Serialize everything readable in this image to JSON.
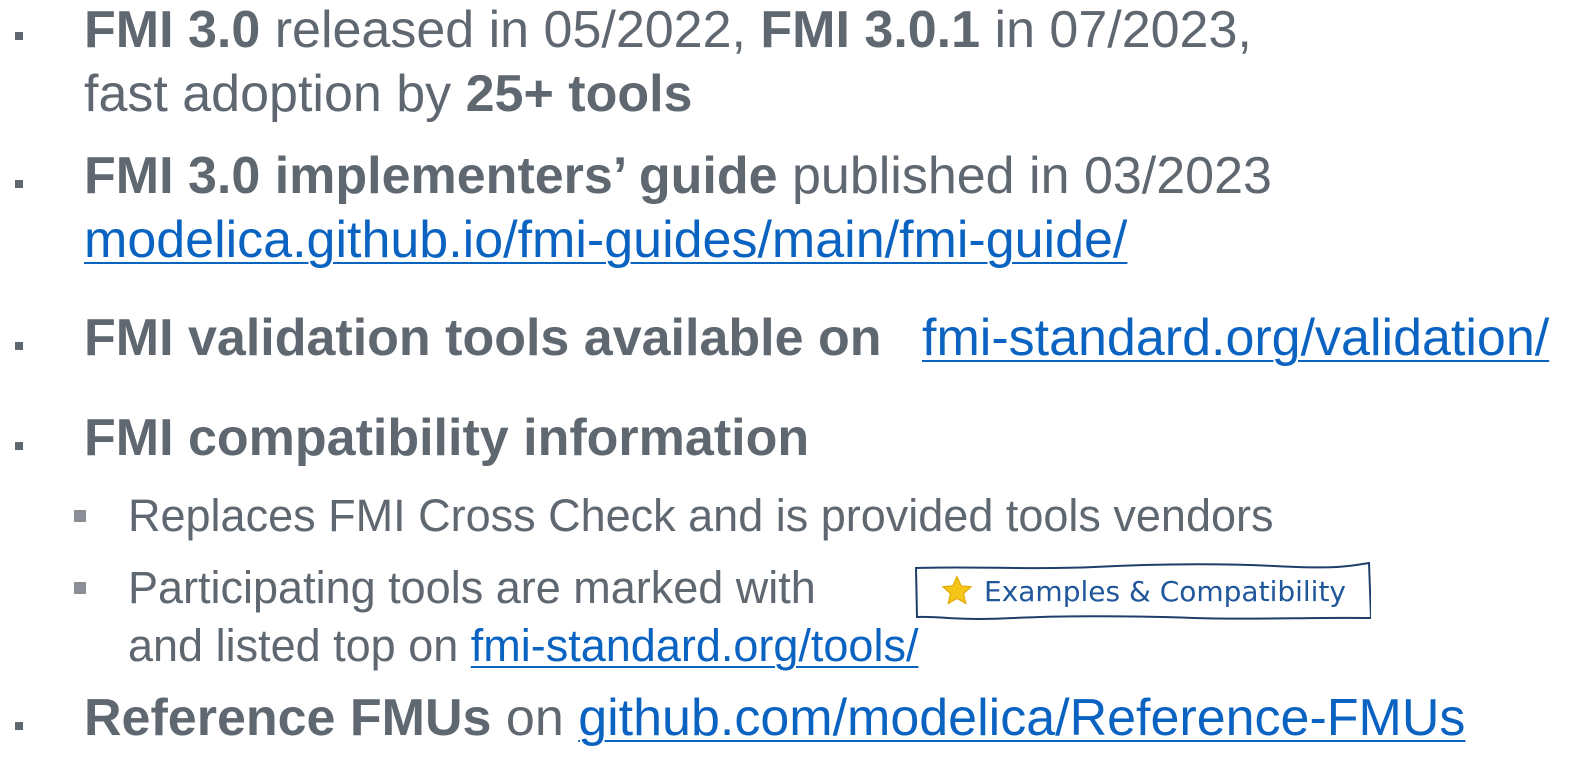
{
  "bullets": {
    "b1": {
      "strong1": "FMI 3.0",
      "text1": " released in 05/2022, ",
      "strong2": "FMI 3.0.1",
      "text2": " in 07/2023,",
      "line2_text": "fast adoption by ",
      "line2_strong": "25+ tools"
    },
    "b2": {
      "strong": "FMI 3.0 implementers’ guide",
      "text": " published in 03/2023",
      "link": "modelica.github.io/fmi-guides/main/fmi-guide/"
    },
    "b3": {
      "strong": "FMI validation tools available on",
      "link": "fmi-standard.org/validation/"
    },
    "b4": {
      "strong": "FMI compatibility information",
      "sub1": "Replaces FMI Cross Check and is provided tools vendors",
      "sub2_line1": "Participating tools are marked with",
      "sub2_line2_text": "and listed top on ",
      "sub2_link": "fmi-standard.org/tools/",
      "badge": {
        "icon": "star-icon",
        "label": "Examples & Compatibility"
      }
    },
    "b5": {
      "strong": "Reference FMUs",
      "text": " on ",
      "link": "github.com/modelica/Reference-FMUs"
    }
  },
  "colors": {
    "text": "#5f6770",
    "link": "#0b63c1",
    "badge_text": "#20579b",
    "star": "#f5c518"
  }
}
